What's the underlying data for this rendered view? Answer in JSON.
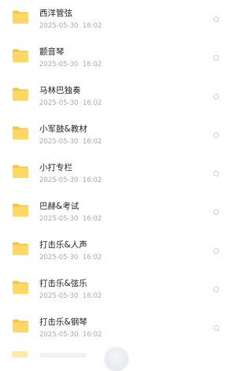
{
  "files": [
    {
      "name": "西洋管弦",
      "date": "2025-05-30",
      "time": "16:02",
      "icon": "folder-icon"
    },
    {
      "name": "颤音琴",
      "date": "2025-05-30",
      "time": "16:02",
      "icon": "folder-icon"
    },
    {
      "name": "马林巴独奏",
      "date": "2025-05-30",
      "time": "16:02",
      "icon": "folder-icon"
    },
    {
      "name": "小军鼓&教材",
      "date": "2025-05-30",
      "time": "16:02",
      "icon": "folder-icon"
    },
    {
      "name": "小打专栏",
      "date": "2025-05-30",
      "time": "16:02",
      "icon": "folder-icon"
    },
    {
      "name": "巴赫&考试",
      "date": "2025-05-30",
      "time": "16:02",
      "icon": "folder-icon"
    },
    {
      "name": "打击乐&人声",
      "date": "2025-05-30",
      "time": "16:02",
      "icon": "folder-icon"
    },
    {
      "name": "打击乐&弦乐",
      "date": "2025-05-30",
      "time": "16:02",
      "icon": "folder-icon"
    },
    {
      "name": "打击乐&钢琴",
      "date": "2025-05-30",
      "time": "16:02",
      "icon": "folder-icon"
    }
  ],
  "colors": {
    "folder_back": "#f7c43a",
    "folder_front": "#fdd866",
    "name_text": "#222222",
    "meta_text": "#a9a9a9"
  }
}
